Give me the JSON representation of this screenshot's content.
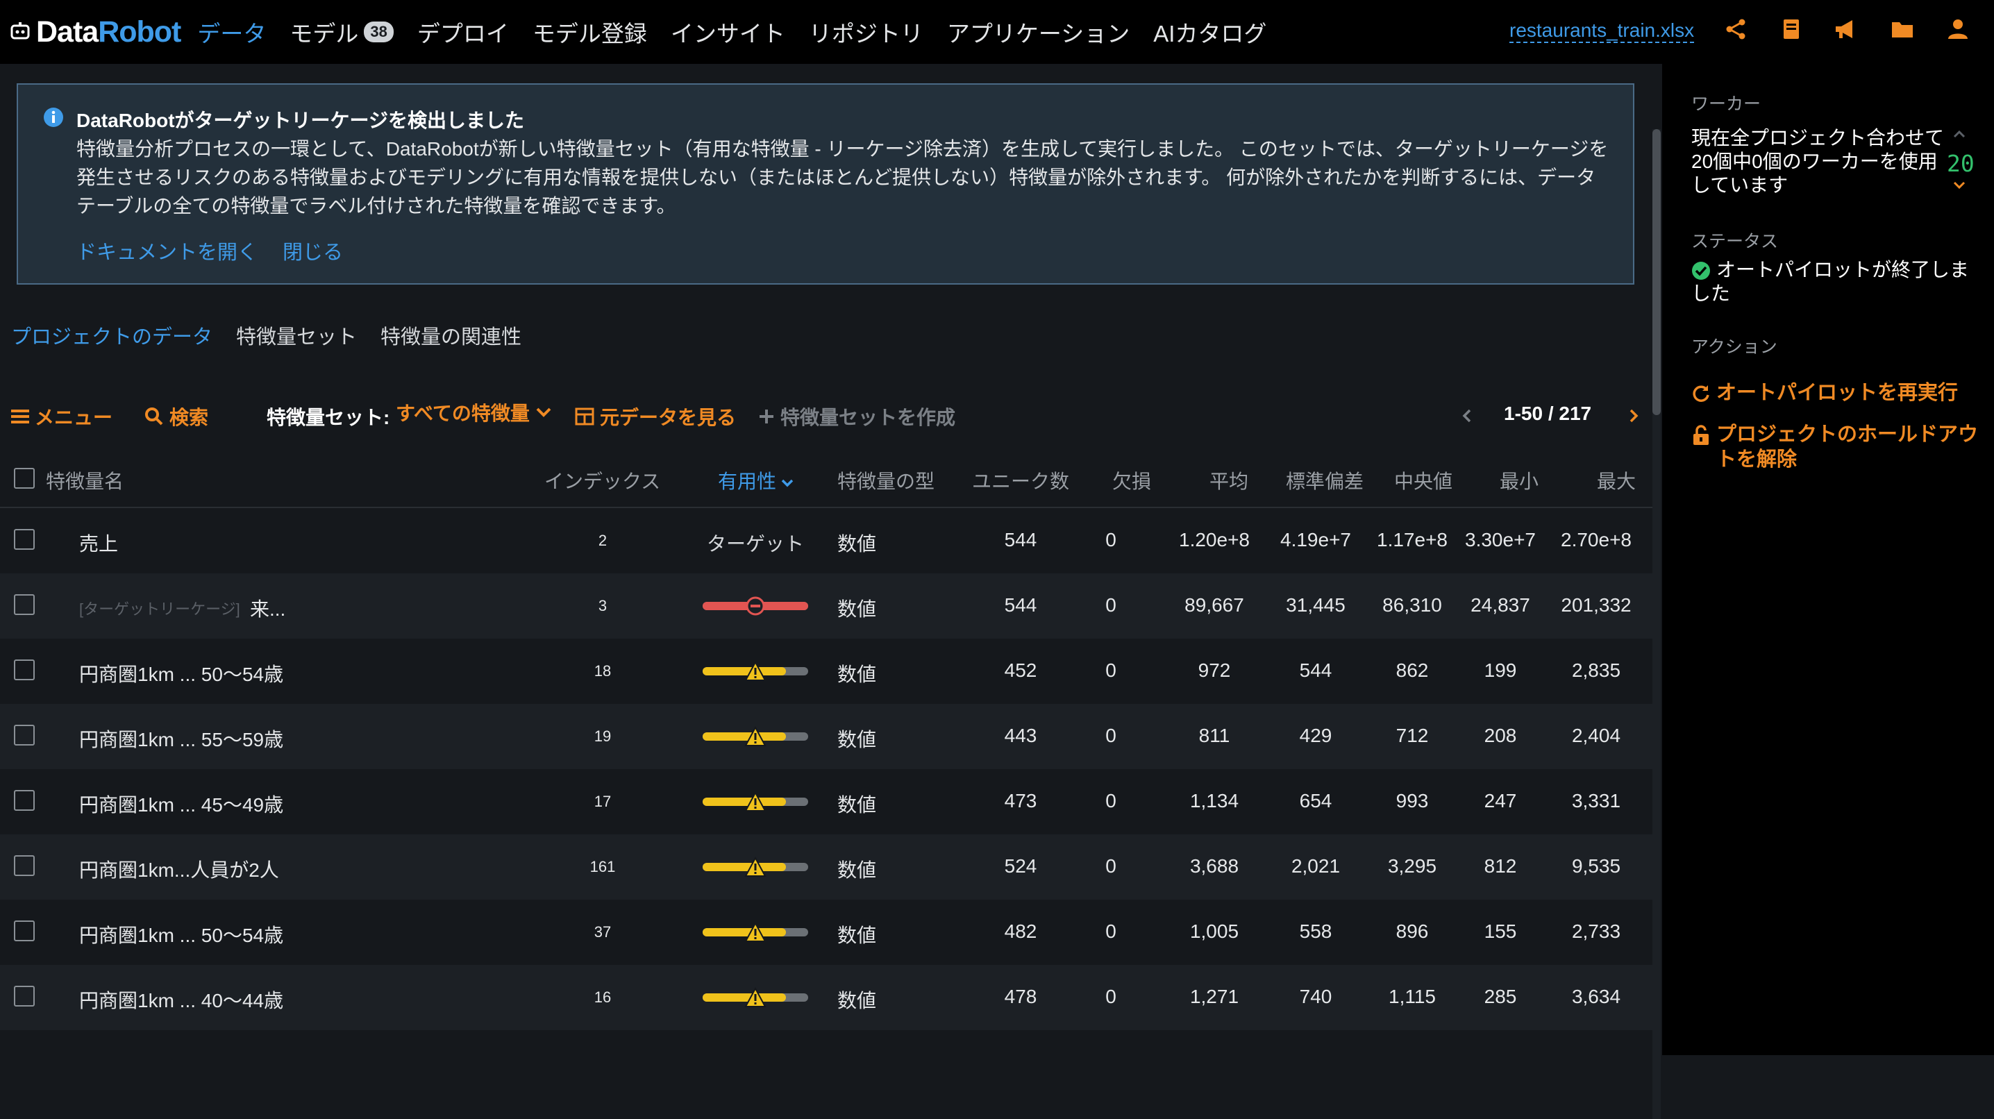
{
  "nav": {
    "logo_data": "Data",
    "logo_robot": "Robot",
    "items": [
      {
        "label": "データ",
        "active": true
      },
      {
        "label": "モデル",
        "badge": "38"
      },
      {
        "label": "デプロイ"
      },
      {
        "label": "モデル登録"
      },
      {
        "label": "インサイト"
      },
      {
        "label": "リポジトリ"
      },
      {
        "label": "アプリケーション"
      },
      {
        "label": "AIカタログ"
      }
    ],
    "file_name": "restaurants_train.xlsx",
    "icons": [
      "share-icon",
      "book-icon",
      "megaphone-icon",
      "folder-icon",
      "user-icon"
    ]
  },
  "alert": {
    "title": "DataRobotがターゲットリーケージを検出しました",
    "body_lines": [
      "特徴量分析プロセスの一環として、DataRobotが新しい特徴量セット（有用な特徴量 - リーケージ除去済）を生成して実行しました。 このセットでは、ターゲットリーケージを",
      "発生させるリスクのある特徴量およびモデリングに有用な情報を提供しない（またはほとんど提供しない）特徴量が除外されます。 何が除外されたかを判断するには、データ",
      "テーブルの全ての特徴量でラベル付けされた特徴量を確認できます。"
    ],
    "link_docs": "ドキュメントを開く",
    "link_close": "閉じる"
  },
  "subtabs": [
    {
      "label": "プロジェクトのデータ",
      "active": true
    },
    {
      "label": "特徴量セット"
    },
    {
      "label": "特徴量の関連性"
    }
  ],
  "toolbar": {
    "menu": "メニュー",
    "search": "検索",
    "featureset_label": "特徴量セット:",
    "featureset_value": "すべての特徴量",
    "view_raw": "元データを見る",
    "create_set": "特徴量セットを作成",
    "pagination": "1-50 / 217"
  },
  "table": {
    "headers": {
      "name": "特徴量名",
      "index": "インデックス",
      "importance": "有用性",
      "type": "特徴量の型",
      "unique": "ユニーク数",
      "missing": "欠損",
      "mean": "平均",
      "std": "標準偏差",
      "median": "中央値",
      "min": "最小",
      "max": "最大"
    },
    "rows": [
      {
        "name": "売上",
        "index": "2",
        "importance_text": "ターゲット",
        "type": "数値",
        "unique": "544",
        "missing": "0",
        "mean": "1.20e+8",
        "std": "4.19e+7",
        "median": "1.17e+8",
        "min": "3.30e+7",
        "max": "2.70e+8"
      },
      {
        "tag": "[ターゲットリーケージ]",
        "name": "来...",
        "index": "3",
        "importance": "leak",
        "type": "数値",
        "unique": "544",
        "missing": "0",
        "mean": "89,667",
        "std": "31,445",
        "median": "86,310",
        "min": "24,837",
        "max": "201,332"
      },
      {
        "name": "円商圏1km ... 50〜54歳",
        "index": "18",
        "importance": "warn",
        "type": "数値",
        "unique": "452",
        "missing": "0",
        "mean": "972",
        "std": "544",
        "median": "862",
        "min": "199",
        "max": "2,835"
      },
      {
        "name": "円商圏1km ... 55〜59歳",
        "index": "19",
        "importance": "warn",
        "type": "数値",
        "unique": "443",
        "missing": "0",
        "mean": "811",
        "std": "429",
        "median": "712",
        "min": "208",
        "max": "2,404"
      },
      {
        "name": "円商圏1km ... 45〜49歳",
        "index": "17",
        "importance": "warn",
        "type": "数値",
        "unique": "473",
        "missing": "0",
        "mean": "1,134",
        "std": "654",
        "median": "993",
        "min": "247",
        "max": "3,331"
      },
      {
        "name": "円商圏1km...人員が2人",
        "index": "161",
        "importance": "warn",
        "type": "数値",
        "unique": "524",
        "missing": "0",
        "mean": "3,688",
        "std": "2,021",
        "median": "3,295",
        "min": "812",
        "max": "9,535"
      },
      {
        "name": "円商圏1km ... 50〜54歳",
        "index": "37",
        "importance": "warn",
        "type": "数値",
        "unique": "482",
        "missing": "0",
        "mean": "1,005",
        "std": "558",
        "median": "896",
        "min": "155",
        "max": "2,733"
      },
      {
        "name": "円商圏1km ... 40〜44歳",
        "index": "16",
        "importance": "warn",
        "type": "数値",
        "unique": "478",
        "missing": "0",
        "mean": "1,271",
        "std": "740",
        "median": "1,115",
        "min": "285",
        "max": "3,634"
      }
    ]
  },
  "side": {
    "workers_heading": "ワーカー",
    "workers_text": [
      "現在全プロジェクト合わせて",
      "20個中0個のワーカーを使用",
      "しています"
    ],
    "workers_count": "20",
    "status_heading": "ステータス",
    "status_text": [
      "オートパイロットが終了しま",
      "した"
    ],
    "actions_heading": "アクション",
    "action_rerun": "オートパイロットを再実行",
    "action_holdout": [
      "プロジェクトのホールドアウ",
      "トを解除"
    ]
  },
  "colors": {
    "accent_blue": "#3f9be8",
    "accent_orange": "#f08a24",
    "leak_red": "#e25552",
    "warn_yellow": "#f0c21b",
    "ok_green": "#33c16c"
  }
}
